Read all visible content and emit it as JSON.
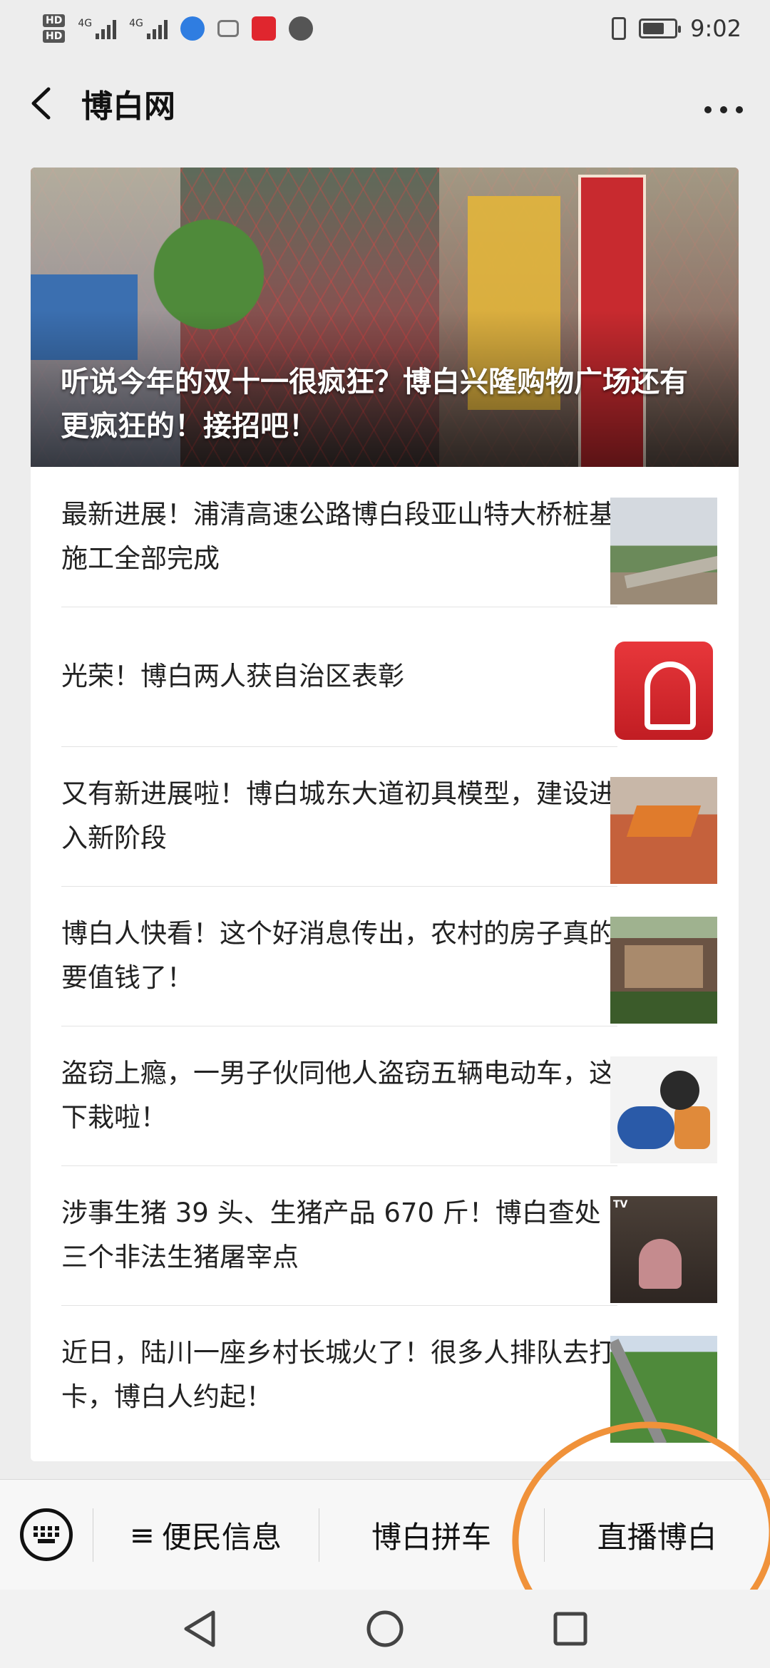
{
  "status_bar": {
    "hd1": "HD",
    "hd2": "HD",
    "net1": "4G",
    "net2": "4G",
    "time": "9:02",
    "battery_level": 0.7
  },
  "header": {
    "title": "博白网"
  },
  "hero": {
    "title": "听说今年的双十一很疯狂？博白兴隆购物广场还有更疯狂的！接招吧！"
  },
  "articles": [
    {
      "title": "最新进展！浦清高速公路博白段亚山特大桥桩基施工全部完成",
      "thumb": "bridge-construction-photo"
    },
    {
      "title": "光荣！博白两人获自治区表彰",
      "thumb": "thumbs-up-logo"
    },
    {
      "title": "又有新进展啦！博白城东大道初具模型，建设进入新阶段",
      "thumb": "excavator-photo"
    },
    {
      "title": "博白人快看！这个好消息传出，农村的房子真的要值钱了！",
      "thumb": "rural-house-photo"
    },
    {
      "title": "盗窃上瘾，一男子伙同他人盗窃五辆电动车，这下栽啦！",
      "thumb": "thief-cartoon"
    },
    {
      "title": "涉事生猪 39 头、生猪产品 670 斤！博白查处三个非法生猪屠宰点",
      "thumb": "pig-slaughter-photo",
      "thumb_label": "TV"
    },
    {
      "title": "近日，陆川一座乡村长城火了！很多人排队去打卡，博白人约起！",
      "thumb": "great-wall-photo"
    }
  ],
  "menu": {
    "keyboard_icon": "keyboard-icon",
    "items": [
      {
        "label": "便民信息",
        "icon": "≡"
      },
      {
        "label": "博白拼车"
      },
      {
        "label": "直播博白"
      }
    ]
  },
  "colors": {
    "annotation": "#f0923a",
    "background": "#ededed"
  }
}
